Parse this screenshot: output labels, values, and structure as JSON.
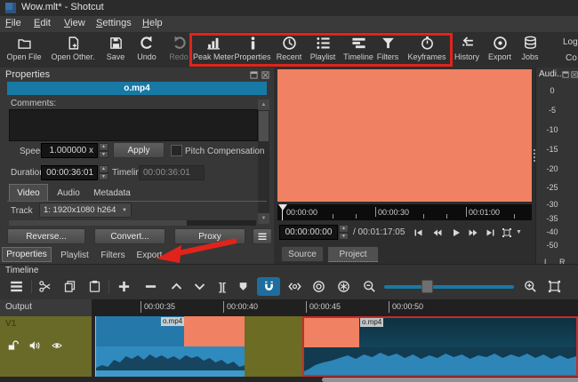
{
  "window": {
    "title": "Wow.mlt* - Shotcut"
  },
  "menu": {
    "items": [
      {
        "first": "F",
        "rest": "ile"
      },
      {
        "first": "E",
        "rest": "dit"
      },
      {
        "first": "V",
        "rest": "iew"
      },
      {
        "first": "S",
        "rest": "ettings"
      },
      {
        "first": "H",
        "rest": "elp"
      }
    ]
  },
  "toolbar": {
    "open_file": "Open File",
    "open_other": "Open Other.",
    "save": "Save",
    "undo": "Undo",
    "redo": "Redo",
    "peak_meter": "Peak Meter",
    "properties": "Properties",
    "recent": "Recent",
    "playlist": "Playlist",
    "timeline": "Timeline",
    "filters": "Filters",
    "keyframes": "Keyframes",
    "history": "History",
    "export": "Export",
    "jobs": "Jobs",
    "truncated_top": "Log",
    "truncated_bottom": "Co"
  },
  "properties": {
    "title": "Properties",
    "clip_name": "o.mp4",
    "comments_label": "Comments:",
    "speed_label": "Speed",
    "speed_value": "1.000000 x",
    "apply": "Apply",
    "pitch_label": "Pitch Compensation",
    "duration_label": "Duration",
    "duration_value": "00:00:36:01",
    "timeline_label": "Timeline",
    "timeline_value": "00:00:36:01",
    "tab_video": "Video",
    "tab_audio": "Audio",
    "tab_metadata": "Metadata",
    "track_label": "Track",
    "track_value": "1: 1920x1080 h264",
    "reverse": "Reverse...",
    "convert": "Convert...",
    "proxy": "Proxy",
    "bottom_tab_properties": "Properties",
    "bottom_tab_playlist": "Playlist",
    "bottom_tab_filters": "Filters",
    "bottom_tab_export": "Export"
  },
  "player": {
    "ruler_start": "00:00:00",
    "ruler_mid": "00:00:30",
    "ruler_end": "00:01:00",
    "position": "00:00:00:00",
    "duration": "/ 00:01:17:05",
    "tab_source": "Source",
    "tab_project": "Project"
  },
  "audio_meter": {
    "title": "Audi...",
    "scale": [
      "0",
      "-5",
      "-10",
      "-15",
      "-20",
      "-25",
      "-30",
      "-35",
      "-40",
      "-50"
    ],
    "left": "L",
    "right": "R"
  },
  "timeline": {
    "title": "Timeline",
    "output": "Output",
    "ruler": [
      "00:00:35",
      "00:00:40",
      "00:00:45",
      "00:00:50"
    ],
    "track": "V1",
    "clip1_label": "o.mp4",
    "clip2_label": "o.mp4",
    "split_glyph": "]["
  },
  "colors": {
    "accent_teal": "#1879A4",
    "preview_salmon": "#F08162",
    "annotation_red": "#E0241B",
    "clip_blue": "#2579AA",
    "clip_olive": "#6A6A26",
    "selected_red": "#C92B2B"
  }
}
